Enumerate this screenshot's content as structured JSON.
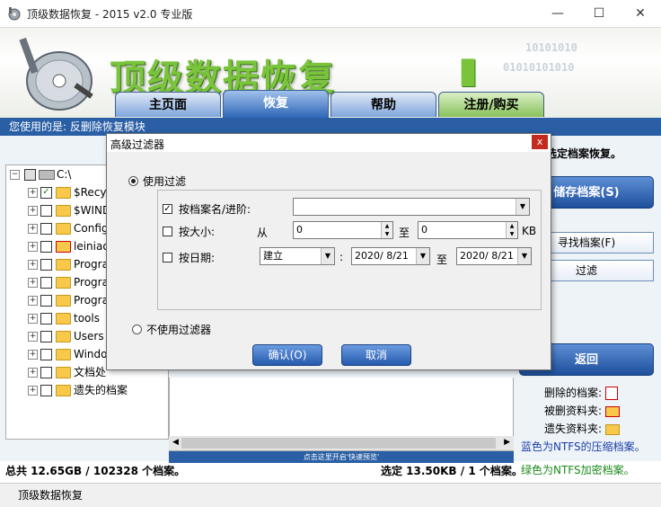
{
  "window": {
    "title": "顶级数据恢复 - 2015 v2.0 专业版",
    "minimize": "—",
    "maximize": "☐",
    "close": "✕"
  },
  "header": {
    "brand": "顶级数据恢复",
    "binary_top": "10101010",
    "binary_bottom": "01010101010",
    "brand_accent": "#7ac43c"
  },
  "tabs": [
    {
      "label": "主页面"
    },
    {
      "label": "恢复"
    },
    {
      "label": "帮助"
    },
    {
      "label": "注册/购买"
    }
  ],
  "band": {
    "text": "您使用的是: 反删除恢复模块"
  },
  "tree": {
    "root": "C:\\",
    "items": [
      {
        "label": "$Recyc"
      },
      {
        "label": "$WIND"
      },
      {
        "label": "Config"
      },
      {
        "label": "leiniao"
      },
      {
        "label": "Progra"
      },
      {
        "label": "Progra"
      },
      {
        "label": "Progra"
      },
      {
        "label": "tools"
      },
      {
        "label": "Users"
      },
      {
        "label": "Windo"
      },
      {
        "label": "文档处"
      },
      {
        "label": "遗失的档案"
      }
    ]
  },
  "list": {
    "hint": "点击这里开启'快速预览'"
  },
  "right": {
    "instruction": "选定档案恢复。",
    "save_button": "储存档案(S)",
    "find_button": "寻找档案(F)",
    "filter_button": "过滤",
    "back_button": "返回",
    "legend": [
      {
        "label": "删除的档案:"
      },
      {
        "label": "被删资料夹:"
      },
      {
        "label": "遗失资料夹:"
      }
    ],
    "blue_note": "蓝色为NTFS的压缩档案。",
    "green_note": "绿色为NTFS加密档案。",
    "blue_color": "#1a3fa6",
    "green_color": "#1d8a1d"
  },
  "status": {
    "total": "总共 12.65GB / 102328 个档案。",
    "selected": "选定 13.50KB / 1 个档案。",
    "bar": "顶级数据恢复"
  },
  "dialog": {
    "title": "高级过滤器",
    "use_filter": "使用过滤",
    "by_name": "按档案名/进阶:",
    "name_value": "",
    "by_size": "按大小:",
    "from": "从",
    "size_from": "0",
    "to": "至",
    "size_to": "0",
    "unit": "KB",
    "by_date": "按日期:",
    "date_type": "建立",
    "colon": ":",
    "date_from": "2020/ 8/21",
    "date_to": "2020/ 8/21",
    "no_filter": "不使用过滤器",
    "ok": "确认(O)",
    "cancel": "取消"
  }
}
